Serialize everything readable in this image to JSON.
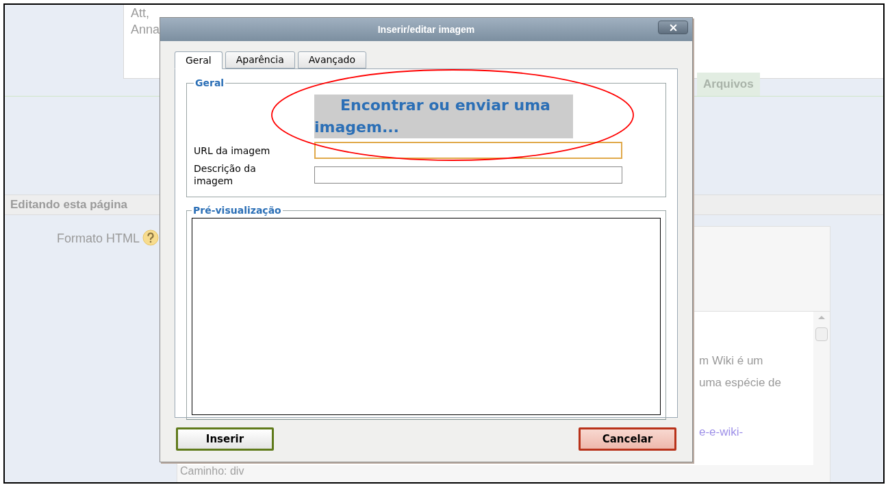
{
  "page": {
    "message_lines": [
      "Att,",
      "Anna"
    ],
    "tab": "Arquivos",
    "section_heading": "Editando esta página",
    "format_label": "Formato HTML",
    "editor": {
      "text_lines": [
        {
          "text": "m Wiki é um",
          "kind": "text"
        },
        {
          "text": "uma espécie de",
          "kind": "text"
        },
        {
          "text": "e-e-wiki-",
          "kind": "link"
        }
      ],
      "path": "Caminho: div"
    }
  },
  "dialog": {
    "title": "Inserir/editar imagem",
    "tabs": [
      {
        "label": "Geral",
        "selected": true
      },
      {
        "label": "Aparência",
        "selected": false
      },
      {
        "label": "Avançado",
        "selected": false
      }
    ],
    "general": {
      "legend": "Geral",
      "browse_link": "Encontrar ou enviar uma imagem...",
      "fields": [
        {
          "label": "URL da imagem",
          "focused": true
        },
        {
          "label": "Descrição da imagem",
          "focused": false
        }
      ]
    },
    "preview": {
      "legend": "Pré-visualização"
    },
    "buttons": [
      {
        "label": "Inserir",
        "kind": "insert"
      },
      {
        "label": "Cancelar",
        "kind": "cancel"
      }
    ]
  }
}
